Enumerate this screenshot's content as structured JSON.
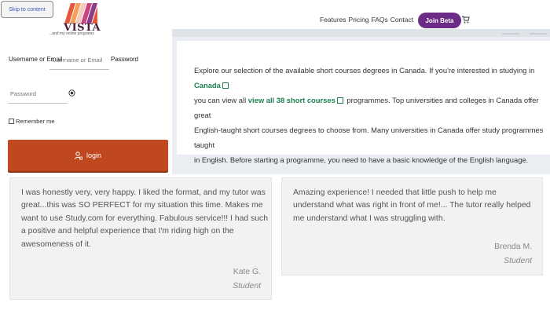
{
  "header": {
    "skip_link": "Skip to content",
    "logo_text": "VISTA",
    "tagline": "...and my online programs",
    "nav": [
      "Features",
      "Pricing",
      "FAQs",
      "Contact"
    ],
    "join_button": "Join Beta"
  },
  "login": {
    "username_label": "Username or Email",
    "username_placeholder": "Username or Email",
    "password_label": "Password",
    "password_placeholder": "Password",
    "remember_label": "Remember me",
    "login_button": "login"
  },
  "info": {
    "line1": "Explore our selection of the available short courses degrees in Canada. If you're interested in studying in",
    "link_canada": "Canada",
    "line2_prefix": "you can view all",
    "link_all": "view all 38 short courses",
    "line2_suffix": "programmes. Top universities and colleges in Canada offer great",
    "line3": "English-taught short courses degrees to choose from. Many universities in Canada offer study programmes taught",
    "line4": "in English. Before starting a programme, you need to have a basic knowledge of the English language."
  },
  "testimonials": [
    {
      "quote": "I was honestly very, very happy. I liked the format, and my tutor was great...this was SO PERFECT for my situation this time. Makes me want to use Study.com for everything. Fabulous service!!! I had such a positive and helpful experience that I'm riding high on the awesomeness of it.",
      "name": "Kate G.",
      "role": "Student"
    },
    {
      "quote": "Amazing experience! I needed that little push to help me understand what was right in front of me!... The tutor really helped me understand what I was struggling with.",
      "name": "Brenda M.",
      "role": "Student"
    }
  ],
  "colors": {
    "join_purple": "#6c2b86",
    "login_orange": "#c0481f",
    "link_green": "#1e8052",
    "panel_bg": "#eaeef2"
  },
  "icons": [
    "shopping-cart-icon",
    "eye-icon",
    "user-lock-icon",
    "external-link-icon"
  ]
}
